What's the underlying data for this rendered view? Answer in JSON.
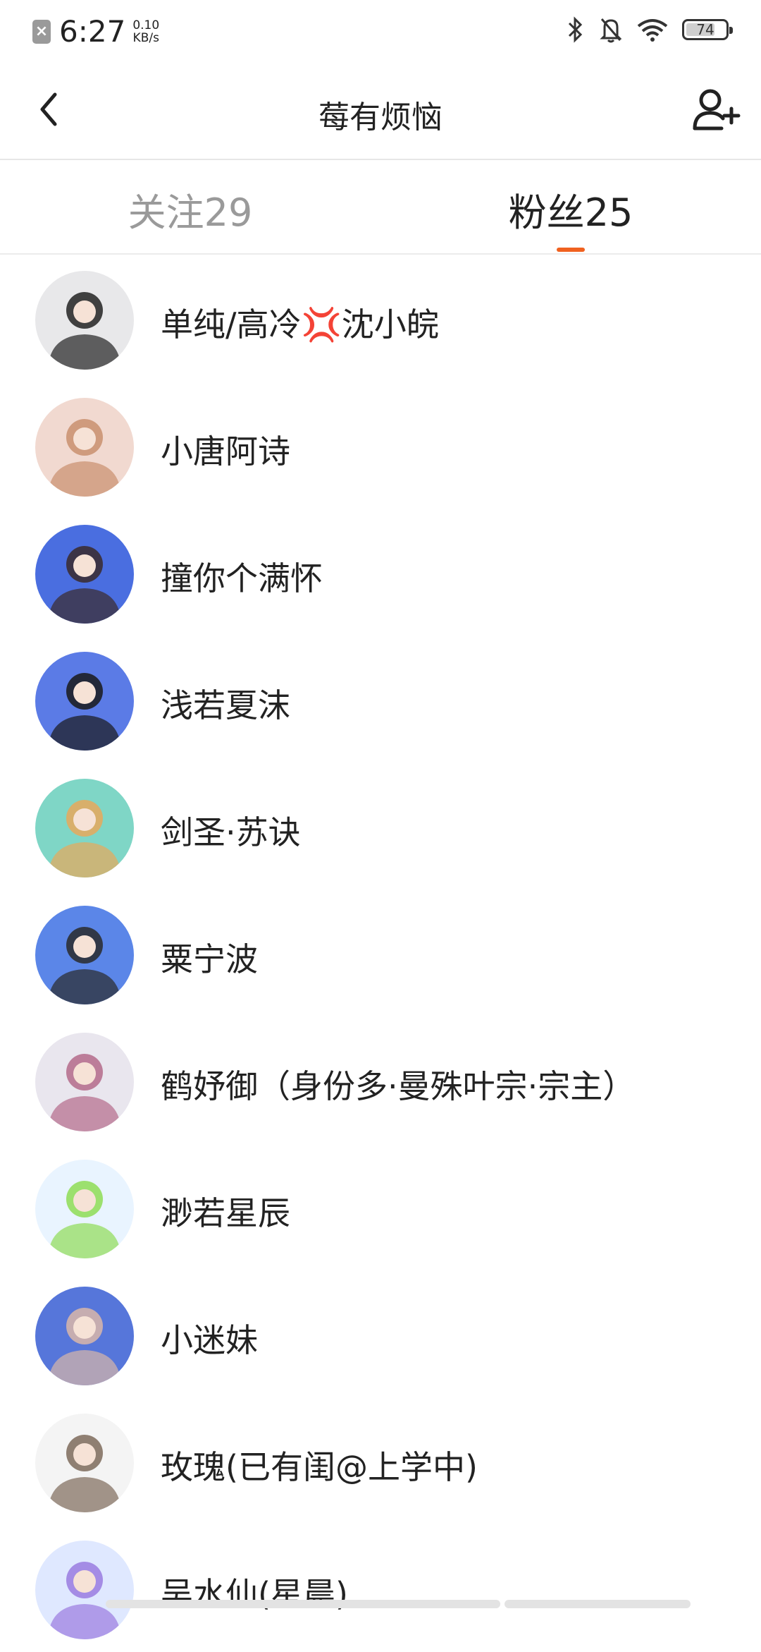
{
  "status_bar": {
    "time": "6:27",
    "net_speed_value": "0.10",
    "net_speed_unit": "KB/s",
    "battery_level": "74",
    "icons": [
      "close-notification-icon",
      "bluetooth-icon",
      "bell-off-icon",
      "wifi-icon",
      "battery-icon"
    ]
  },
  "header": {
    "title": "莓有烦恼",
    "back_icon": "chevron-left-icon",
    "add_icon": "add-user-icon"
  },
  "tabs": [
    {
      "label": "关注29",
      "active": false
    },
    {
      "label": "粉丝25",
      "active": true
    }
  ],
  "accent_color": "#f0611f",
  "fans": [
    {
      "name": "单纯/高冷💢沈小皖",
      "avatar_colors": [
        "#e8e8ea",
        "#222222"
      ]
    },
    {
      "name": "小唐阿诗",
      "avatar_colors": [
        "#f1d9d0",
        "#c98f6e"
      ]
    },
    {
      "name": "撞你个满怀",
      "avatar_colors": [
        "#4a6ee0",
        "#3a2a2a"
      ]
    },
    {
      "name": "浅若夏沫",
      "avatar_colors": [
        "#5b7be6",
        "#1a1a1a"
      ]
    },
    {
      "name": "剑圣·苏诀",
      "avatar_colors": [
        "#7fd6c6",
        "#e8a85a"
      ]
    },
    {
      "name": "粟宁波",
      "avatar_colors": [
        "#5b86e8",
        "#2a2a2a"
      ]
    },
    {
      "name": "鹤妤御（身份多·曼殊叶宗·宗主）",
      "avatar_colors": [
        "#e9e6ee",
        "#b46a8a"
      ]
    },
    {
      "name": "渺若星辰",
      "avatar_colors": [
        "#e9f4ff",
        "#8edc55"
      ]
    },
    {
      "name": "小迷妹",
      "avatar_colors": [
        "#5676da",
        "#d9b7a8"
      ]
    },
    {
      "name": "玫瑰(已有闺@上学中)",
      "avatar_colors": [
        "#f4f4f4",
        "#7d6a5a"
      ]
    },
    {
      "name": "吴水仙(星晨)",
      "avatar_colors": [
        "#dfe8ff",
        "#9a7be0"
      ]
    }
  ]
}
